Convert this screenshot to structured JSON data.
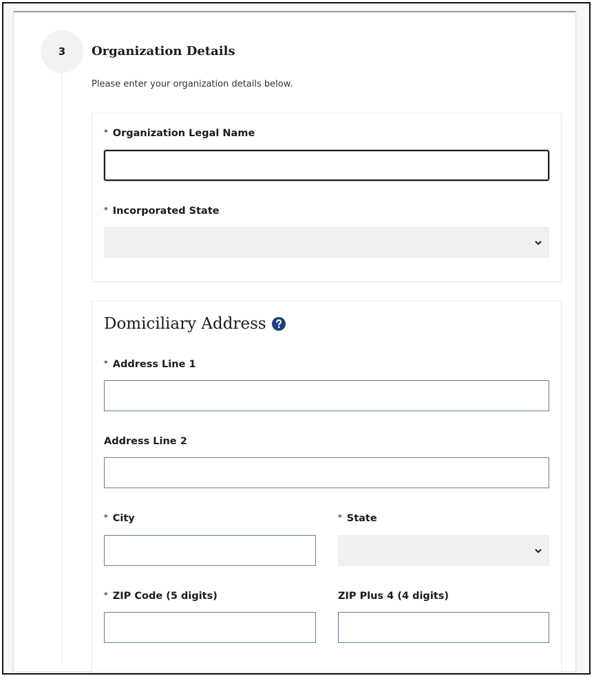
{
  "step": {
    "number": "3",
    "title": "Organization Details",
    "description": "Please enter your organization details below."
  },
  "organization": {
    "legal_name": {
      "label": "Organization Legal Name",
      "value": "",
      "required": true
    },
    "incorporated_state": {
      "label": "Incorporated State",
      "selected": "",
      "required": true
    }
  },
  "address": {
    "heading": "Domiciliary Address",
    "line1": {
      "label": "Address Line 1",
      "value": "",
      "required": true
    },
    "line2": {
      "label": "Address Line 2",
      "value": "",
      "required": false
    },
    "city": {
      "label": "City",
      "value": "",
      "required": true
    },
    "state": {
      "label": "State",
      "selected": "",
      "required": true
    },
    "zip": {
      "label": "ZIP Code (5 digits)",
      "value": "",
      "required": true
    },
    "zip4": {
      "label": "ZIP Plus 4 (4 digits)",
      "value": "",
      "required": false
    }
  },
  "symbols": {
    "required_marker": "*",
    "help_icon": "question-circle-icon",
    "dropdown_icon": "chevron-down-icon"
  },
  "colors": {
    "required": "#9b1c1c",
    "input_border": "#5b7f9e",
    "help_icon": "#1a4480",
    "select_bg": "#f0f0f0"
  }
}
